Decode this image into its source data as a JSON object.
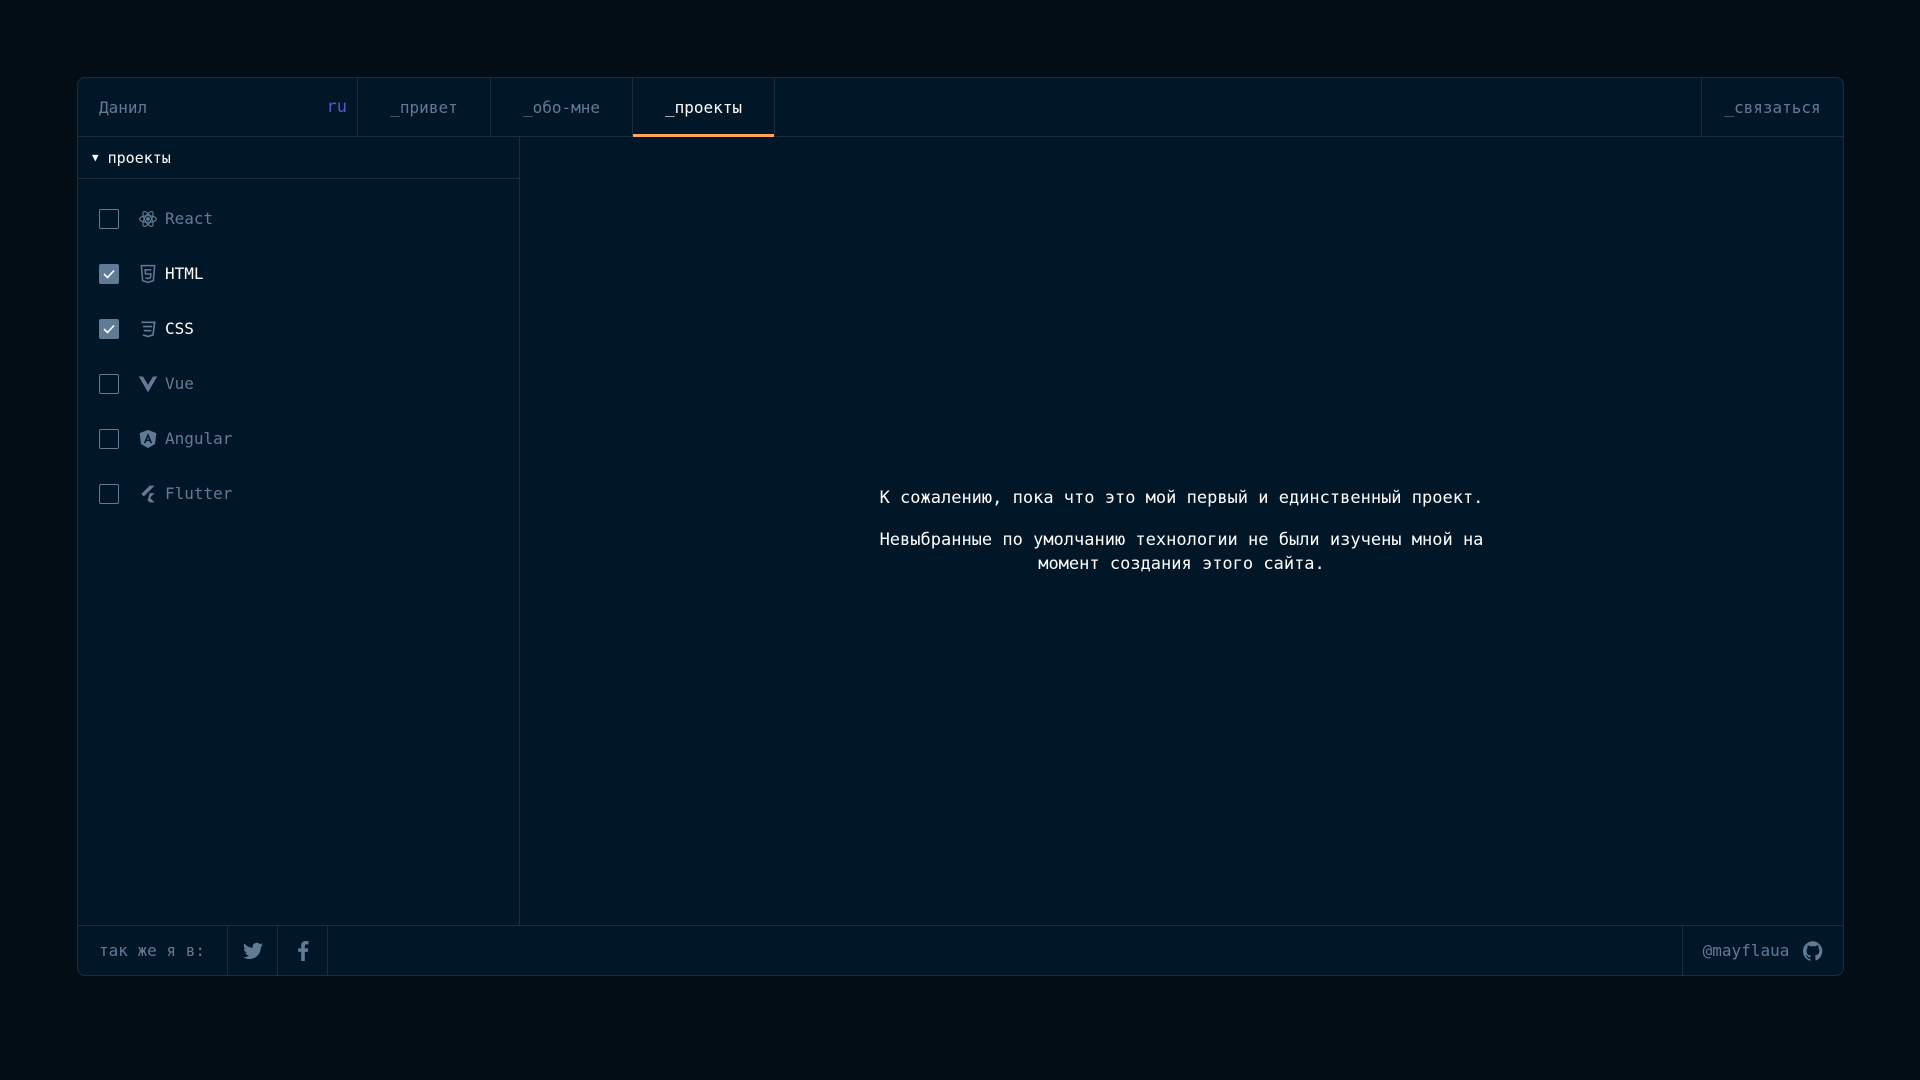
{
  "header": {
    "name": "Данил",
    "lang": "ru",
    "tabs": [
      {
        "label": "_привет"
      },
      {
        "label": "_обо-мне"
      },
      {
        "label": "_проекты"
      }
    ],
    "contact": "_связаться",
    "active_tab_color": "#fea55f"
  },
  "sidebar": {
    "section": "проекты",
    "filters": [
      {
        "label": "React",
        "checked": false,
        "icon": "react-icon"
      },
      {
        "label": "HTML",
        "checked": true,
        "icon": "html5-icon"
      },
      {
        "label": "CSS",
        "checked": true,
        "icon": "css3-icon"
      },
      {
        "label": "Vue",
        "checked": false,
        "icon": "vue-icon"
      },
      {
        "label": "Angular",
        "checked": false,
        "icon": "angular-icon"
      },
      {
        "label": "Flutter",
        "checked": false,
        "icon": "flutter-icon"
      }
    ]
  },
  "main": {
    "message_1": "К сожалению, пока что это мой первый и единственный проект.",
    "message_2": "Невыбранные по умолчанию технологии не были изучены мной на момент создания этого сайта."
  },
  "footer": {
    "follow": "так же я в:",
    "socials": [
      "twitter-icon",
      "facebook-icon"
    ],
    "github_user": "@mayflaua"
  },
  "colors": {
    "background": "#011627",
    "border": "#1e2d3d",
    "muted_text": "#607b96",
    "accent_lang": "#4d5bce"
  }
}
